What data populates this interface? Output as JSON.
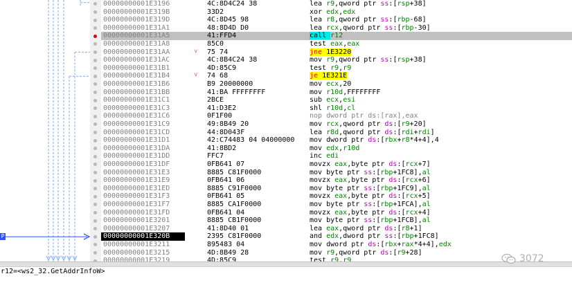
{
  "ip_tag": "P",
  "status_text": "r12=<ws2_32.GetAddrInfoW>",
  "watermark": {
    "icon": "wechat-icon",
    "text": "3072"
  },
  "colors": {
    "call_bg": "#00e8e8",
    "jcc_bg": "#ffff00",
    "jcc_fg": "#ff0000",
    "register": "#008000",
    "segment": "#c000c0",
    "breakpoint": "#e00000",
    "ip_arrow": "#3050ff"
  },
  "rows": [
    {
      "addr": "00000000001E3196",
      "bytes": "4C:8D4C24 38",
      "jmark": "",
      "tokens": [
        [
          "mnem",
          "lea "
        ],
        [
          "reg",
          "r9"
        ],
        [
          "mem",
          ",qword ptr "
        ],
        [
          "seg",
          "ss"
        ],
        [
          "mem",
          ":["
        ],
        [
          "reg",
          "rsp"
        ],
        [
          "num",
          "+38"
        ],
        [
          "mem",
          "]"
        ]
      ]
    },
    {
      "addr": "00000000001E319B",
      "bytes": "33D2",
      "jmark": "",
      "tokens": [
        [
          "mnem",
          "xor "
        ],
        [
          "reg",
          "edx"
        ],
        [
          "mem",
          ","
        ],
        [
          "reg",
          "edx"
        ]
      ]
    },
    {
      "addr": "00000000001E319D",
      "bytes": "4C:8D45 98",
      "jmark": "",
      "tokens": [
        [
          "mnem",
          "lea "
        ],
        [
          "reg",
          "r8"
        ],
        [
          "mem",
          ",qword ptr "
        ],
        [
          "seg",
          "ss"
        ],
        [
          "mem",
          ":["
        ],
        [
          "reg",
          "rbp"
        ],
        [
          "num",
          "-68"
        ],
        [
          "mem",
          "]"
        ]
      ]
    },
    {
      "addr": "00000000001E31A1",
      "bytes": "48:8D4D D0",
      "jmark": "",
      "tokens": [
        [
          "mnem",
          "lea "
        ],
        [
          "reg",
          "rcx"
        ],
        [
          "mem",
          ",qword ptr "
        ],
        [
          "seg",
          "ss"
        ],
        [
          "mem",
          ":["
        ],
        [
          "reg",
          "rbp"
        ],
        [
          "num",
          "-30"
        ],
        [
          "mem",
          "]"
        ]
      ]
    },
    {
      "addr": "00000000001E31A5",
      "bytes": "41:FFD4",
      "jmark": "",
      "bp": true,
      "hl": true,
      "tokens": [
        [
          "call",
          "call "
        ],
        [
          "reg",
          "r12"
        ]
      ]
    },
    {
      "addr": "00000000001E31A8",
      "bytes": "85C0",
      "jmark": "",
      "tokens": [
        [
          "mnem",
          "test "
        ],
        [
          "reg",
          "eax"
        ],
        [
          "mem",
          ","
        ],
        [
          "reg",
          "eax"
        ]
      ]
    },
    {
      "addr": "00000000001E31AA",
      "bytes": "75 74",
      "jmark": "˅",
      "tokens": [
        [
          "jcc",
          "jne "
        ],
        [
          "jtgt",
          "1E3220"
        ]
      ]
    },
    {
      "addr": "00000000001E31AC",
      "bytes": "4C:8B4C24 38",
      "jmark": "",
      "tokens": [
        [
          "mnem",
          "mov "
        ],
        [
          "reg",
          "r9"
        ],
        [
          "mem",
          ",qword ptr "
        ],
        [
          "seg",
          "ss"
        ],
        [
          "mem",
          ":["
        ],
        [
          "reg",
          "rsp"
        ],
        [
          "num",
          "+38"
        ],
        [
          "mem",
          "]"
        ]
      ]
    },
    {
      "addr": "00000000001E31B1",
      "bytes": "4D:85C9",
      "jmark": "",
      "tokens": [
        [
          "mnem",
          "test "
        ],
        [
          "reg",
          "r9"
        ],
        [
          "mem",
          ","
        ],
        [
          "reg",
          "r9"
        ]
      ]
    },
    {
      "addr": "00000000001E31B4",
      "bytes": "74 68",
      "jmark": "˅",
      "tokens": [
        [
          "jcc",
          "je "
        ],
        [
          "jtgt",
          "1E321E"
        ]
      ]
    },
    {
      "addr": "00000000001E31B6",
      "bytes": "B9 20000000",
      "jmark": "",
      "tokens": [
        [
          "mnem",
          "mov "
        ],
        [
          "reg",
          "ecx"
        ],
        [
          "mem",
          ","
        ],
        [
          "num",
          "20"
        ]
      ]
    },
    {
      "addr": "00000000001E31BB",
      "bytes": "41:BA FFFFFFFF",
      "jmark": "",
      "tokens": [
        [
          "mnem",
          "mov "
        ],
        [
          "reg",
          "r10d"
        ],
        [
          "mem",
          ","
        ],
        [
          "num",
          "FFFFFFFF"
        ]
      ]
    },
    {
      "addr": "00000000001E31C1",
      "bytes": "2BCE",
      "jmark": "",
      "tokens": [
        [
          "mnem",
          "sub "
        ],
        [
          "reg",
          "ecx"
        ],
        [
          "mem",
          ","
        ],
        [
          "reg",
          "esi"
        ]
      ]
    },
    {
      "addr": "00000000001E31C3",
      "bytes": "41:D3E2",
      "jmark": "",
      "tokens": [
        [
          "mnem",
          "shl "
        ],
        [
          "reg",
          "r10d"
        ],
        [
          "mem",
          ","
        ],
        [
          "reg",
          "cl"
        ]
      ]
    },
    {
      "addr": "00000000001E31C6",
      "bytes": "0F1F00",
      "jmark": "",
      "tokens": [
        [
          "nop",
          "nop dword ptr ds:[rax],eax"
        ]
      ]
    },
    {
      "addr": "00000000001E31C9",
      "bytes": "49:8B49 20",
      "jmark": "",
      "tokens": [
        [
          "mnem",
          "mov "
        ],
        [
          "reg",
          "rcx"
        ],
        [
          "mem",
          ",qword ptr "
        ],
        [
          "seg",
          "ds"
        ],
        [
          "mem",
          ":["
        ],
        [
          "reg",
          "r9"
        ],
        [
          "num",
          "+20"
        ],
        [
          "mem",
          "]"
        ]
      ]
    },
    {
      "addr": "00000000001E31CD",
      "bytes": "44:8D043F",
      "jmark": "",
      "tokens": [
        [
          "mnem",
          "lea "
        ],
        [
          "reg",
          "r8d"
        ],
        [
          "mem",
          ",qword ptr "
        ],
        [
          "seg",
          "ds"
        ],
        [
          "mem",
          ":["
        ],
        [
          "reg",
          "rdi"
        ],
        [
          "num",
          "+"
        ],
        [
          "reg",
          "rdi"
        ],
        [
          "mem",
          "]"
        ]
      ]
    },
    {
      "addr": "00000000001E31D1",
      "bytes": "42:C74483 04 04000000",
      "jmark": "",
      "tokens": [
        [
          "mnem",
          "mov "
        ],
        [
          "mem",
          "dword ptr "
        ],
        [
          "seg",
          "ds"
        ],
        [
          "mem",
          ":["
        ],
        [
          "reg",
          "rbx"
        ],
        [
          "num",
          "+"
        ],
        [
          "reg",
          "r8"
        ],
        [
          "num",
          "*4+4"
        ],
        [
          "mem",
          "],"
        ],
        [
          "num",
          "4"
        ]
      ]
    },
    {
      "addr": "00000000001E31DA",
      "bytes": "41:8BD2",
      "jmark": "",
      "tokens": [
        [
          "mnem",
          "mov "
        ],
        [
          "reg",
          "edx"
        ],
        [
          "mem",
          ","
        ],
        [
          "reg",
          "r10d"
        ]
      ]
    },
    {
      "addr": "00000000001E31DD",
      "bytes": "FFC7",
      "jmark": "",
      "tokens": [
        [
          "mnem",
          "inc "
        ],
        [
          "reg",
          "edi"
        ]
      ]
    },
    {
      "addr": "00000000001E31DF",
      "bytes": "0FB641 07",
      "jmark": "",
      "tokens": [
        [
          "mnem",
          "movzx "
        ],
        [
          "reg",
          "eax"
        ],
        [
          "mem",
          ",byte ptr "
        ],
        [
          "seg",
          "ds"
        ],
        [
          "mem",
          ":["
        ],
        [
          "reg",
          "rcx"
        ],
        [
          "num",
          "+7"
        ],
        [
          "mem",
          "]"
        ]
      ]
    },
    {
      "addr": "00000000001E31E3",
      "bytes": "8885 C81F0000",
      "jmark": "",
      "tokens": [
        [
          "mnem",
          "mov "
        ],
        [
          "mem",
          "byte ptr "
        ],
        [
          "seg",
          "ss"
        ],
        [
          "mem",
          ":["
        ],
        [
          "reg",
          "rbp"
        ],
        [
          "num",
          "+1FC8"
        ],
        [
          "mem",
          "],"
        ],
        [
          "reg",
          "al"
        ]
      ]
    },
    {
      "addr": "00000000001E31E9",
      "bytes": "0FB641 06",
      "jmark": "",
      "tokens": [
        [
          "mnem",
          "movzx "
        ],
        [
          "reg",
          "eax"
        ],
        [
          "mem",
          ",byte ptr "
        ],
        [
          "seg",
          "ds"
        ],
        [
          "mem",
          ":["
        ],
        [
          "reg",
          "rcx"
        ],
        [
          "num",
          "+6"
        ],
        [
          "mem",
          "]"
        ]
      ]
    },
    {
      "addr": "00000000001E31ED",
      "bytes": "8885 C91F0000",
      "jmark": "",
      "tokens": [
        [
          "mnem",
          "mov "
        ],
        [
          "mem",
          "byte ptr "
        ],
        [
          "seg",
          "ss"
        ],
        [
          "mem",
          ":["
        ],
        [
          "reg",
          "rbp"
        ],
        [
          "num",
          "+1FC9"
        ],
        [
          "mem",
          "],"
        ],
        [
          "reg",
          "al"
        ]
      ]
    },
    {
      "addr": "00000000001E31F3",
      "bytes": "0FB641 05",
      "jmark": "",
      "tokens": [
        [
          "mnem",
          "movzx "
        ],
        [
          "reg",
          "eax"
        ],
        [
          "mem",
          ",byte ptr "
        ],
        [
          "seg",
          "ds"
        ],
        [
          "mem",
          ":["
        ],
        [
          "reg",
          "rcx"
        ],
        [
          "num",
          "+5"
        ],
        [
          "mem",
          "]"
        ]
      ]
    },
    {
      "addr": "00000000001E31F7",
      "bytes": "8885 CA1F0000",
      "jmark": "",
      "tokens": [
        [
          "mnem",
          "mov "
        ],
        [
          "mem",
          "byte ptr "
        ],
        [
          "seg",
          "ss"
        ],
        [
          "mem",
          ":["
        ],
        [
          "reg",
          "rbp"
        ],
        [
          "num",
          "+1FCA"
        ],
        [
          "mem",
          "],"
        ],
        [
          "reg",
          "al"
        ]
      ]
    },
    {
      "addr": "00000000001E31FD",
      "bytes": "0FB641 04",
      "jmark": "",
      "tokens": [
        [
          "mnem",
          "movzx "
        ],
        [
          "reg",
          "eax"
        ],
        [
          "mem",
          ",byte ptr "
        ],
        [
          "seg",
          "ds"
        ],
        [
          "mem",
          ":["
        ],
        [
          "reg",
          "rcx"
        ],
        [
          "num",
          "+4"
        ],
        [
          "mem",
          "]"
        ]
      ]
    },
    {
      "addr": "00000000001E3201",
      "bytes": "8885 CB1F0000",
      "jmark": "",
      "tokens": [
        [
          "mnem",
          "mov "
        ],
        [
          "mem",
          "byte ptr "
        ],
        [
          "seg",
          "ss"
        ],
        [
          "mem",
          ":["
        ],
        [
          "reg",
          "rbp"
        ],
        [
          "num",
          "+1FCB"
        ],
        [
          "mem",
          "],"
        ],
        [
          "reg",
          "al"
        ]
      ]
    },
    {
      "addr": "00000000001E3207",
      "bytes": "41:8D40 01",
      "jmark": "",
      "tokens": [
        [
          "mnem",
          "lea "
        ],
        [
          "reg",
          "eax"
        ],
        [
          "mem",
          ",qword ptr "
        ],
        [
          "seg",
          "ds"
        ],
        [
          "mem",
          ":["
        ],
        [
          "reg",
          "r8"
        ],
        [
          "num",
          "+1"
        ],
        [
          "mem",
          "]"
        ]
      ]
    },
    {
      "addr": "00000000001E320B",
      "bytes": "2395 C81F0000",
      "jmark": "",
      "cur": true,
      "tokens": [
        [
          "mnem",
          "and "
        ],
        [
          "reg",
          "edx"
        ],
        [
          "mem",
          ",dword ptr "
        ],
        [
          "seg",
          "ss"
        ],
        [
          "mem",
          ":["
        ],
        [
          "reg",
          "rbp"
        ],
        [
          "num",
          "+1FC8"
        ],
        [
          "mem",
          "]"
        ]
      ]
    },
    {
      "addr": "00000000001E3211",
      "bytes": "895483 04",
      "jmark": "",
      "tokens": [
        [
          "mnem",
          "mov "
        ],
        [
          "mem",
          "dword ptr "
        ],
        [
          "seg",
          "ds"
        ],
        [
          "mem",
          ":["
        ],
        [
          "reg",
          "rbx"
        ],
        [
          "num",
          "+"
        ],
        [
          "reg",
          "rax"
        ],
        [
          "num",
          "*4+4"
        ],
        [
          "mem",
          "],"
        ],
        [
          "reg",
          "edx"
        ]
      ]
    },
    {
      "addr": "00000000001E3215",
      "bytes": "4D:8B49 28",
      "jmark": "",
      "tokens": [
        [
          "mnem",
          "mov "
        ],
        [
          "reg",
          "r9"
        ],
        [
          "mem",
          ",qword ptr "
        ],
        [
          "seg",
          "ds"
        ],
        [
          "mem",
          ":["
        ],
        [
          "reg",
          "r9"
        ],
        [
          "num",
          "+28"
        ],
        [
          "mem",
          "]"
        ]
      ]
    },
    {
      "addr": "00000000001E3219",
      "bytes": "4D:85C9",
      "jmark": "",
      "tokens": [
        [
          "mnem",
          "test "
        ],
        [
          "reg",
          "r9"
        ],
        [
          "mem",
          ","
        ],
        [
          "reg",
          "r9"
        ]
      ]
    }
  ]
}
